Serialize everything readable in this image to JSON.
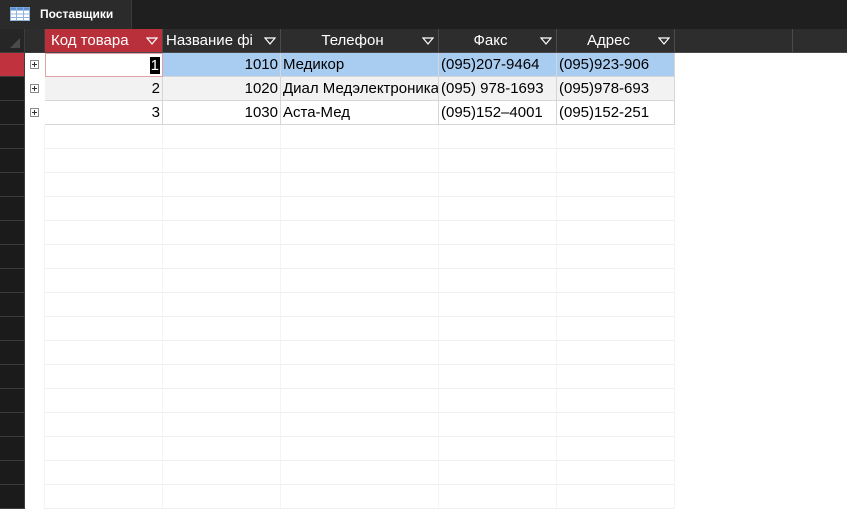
{
  "tab": {
    "title": "Поставщики",
    "icon": "table-icon"
  },
  "table": {
    "columns": [
      {
        "label": "Код товара",
        "filter_icon": "filter-dropdown-icon"
      },
      {
        "label": "Название фі",
        "filter_icon": "filter-dropdown-icon"
      },
      {
        "label": "Телефон",
        "filter_icon": "filter-dropdown-icon"
      },
      {
        "label": "Факс",
        "filter_icon": "filter-dropdown-icon"
      },
      {
        "label": "Адрес",
        "filter_icon": "filter-dropdown-icon"
      }
    ],
    "rows": [
      {
        "code": "1",
        "name": "1010",
        "phone": "Медикор",
        "fax": "(095)207-9464",
        "address": "(095)923-906"
      },
      {
        "code": "2",
        "name": "1020",
        "phone": "Диал Медэлектроника",
        "fax": "(095) 978-1693",
        "address": "(095)978-693"
      },
      {
        "code": "3",
        "name": "1030",
        "phone": "Аста-Мед",
        "fax": "(095)152–4001",
        "address": "(095)152-251"
      }
    ],
    "expander_icon": "plus-expand-icon"
  },
  "colors": {
    "active_accent": "#c0323d",
    "selected_row": "#a9cdf1",
    "header_bg": "#2d2d2d",
    "background": "#1f1f1f"
  }
}
